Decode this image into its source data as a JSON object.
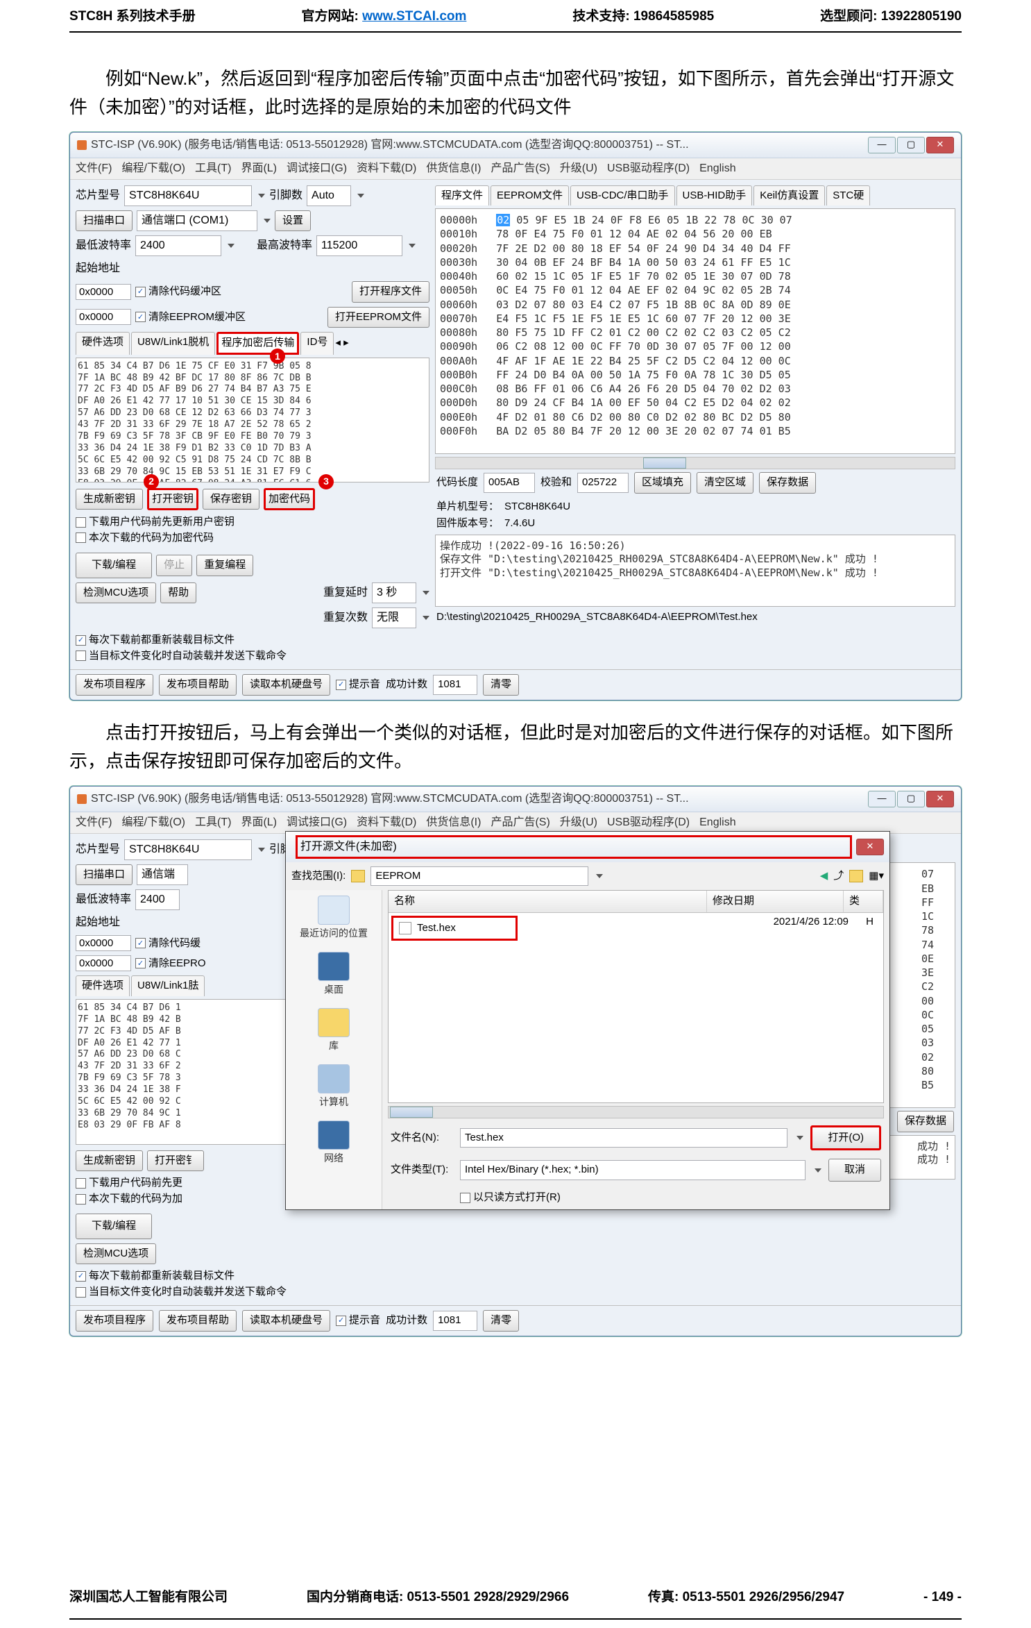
{
  "header": {
    "title": "STC8H 系列技术手册",
    "site_label": "官方网站: ",
    "site_url": "www.STCAI.com",
    "support": "技术支持: 19864585985",
    "consult": "选型顾问: 13922805190"
  },
  "para1": "例如“New.k”，然后返回到“程序加密后传输”页面中点击“加密代码”按钮，如下图所示，首先会弹出“打开源文件（未加密）”的对话框，此时选择的是原始的未加密的代码文件",
  "win": {
    "title": "STC-ISP (V6.90K) (服务电话/销售电话: 0513-55012928)  官网:www.STCMCUDATA.com  (选型咨询QQ:800003751) -- ST...",
    "menus": [
      "文件(F)",
      "编程/下载(O)",
      "工具(T)",
      "界面(L)",
      "调试接口(G)",
      "资料下载(D)",
      "供货信息(I)",
      "产品广告(S)",
      "升级(U)",
      "USB驱动程序(D)",
      "English"
    ],
    "chip_label": "芯片型号",
    "chip_value": "STC8H8K64U",
    "pin_label": "引脚数",
    "pin_value": "Auto",
    "set_btn": "设置",
    "scan_label": "扫描串口",
    "scan_value": "通信端口 (COM1)",
    "baud_min_label": "最低波特率",
    "baud_min": "2400",
    "baud_max_label": "最高波特率",
    "baud_max": "115200",
    "addr_label": "起始地址",
    "addr1": "0x0000",
    "addr2": "0x0000",
    "clear_code": "清除代码缓冲区",
    "clear_eeprom": "清除EEPROM缓冲区",
    "open_prog": "打开程序文件",
    "open_eeprom": "打开EEPROM文件",
    "hw_tabs": [
      "硬件选项",
      "U8W/Link1脱机",
      "程序加密后传输",
      "ID号"
    ],
    "key_block": "61 85 34 C4 B7 D6 1E 75 CF E0 31 F7 9B 05 8 \n7F 1A BC 48 B9 42 BF DC 17 80 8F 86 7C DB B \n77 2C F3 4D D5 AF B9 D6 27 74 B4 B7 A3 75 E \nDF A0 26 E1 42 77 17 10 51 30 CE 15 3D 84 6 \n57 A6 DD 23 D0 68 CE 12 D2 63 66 D3 74 77 3 \n43 7F 2D 31 33 6F 29 7E 18 A7 2E 52 78 65 2 \n7B F9 69 C3 5F 78 3F CB 9F E0 FE B0 70 79 3 \n33 36 D4 24 1E 38 F9 D1 B2 33 C0 1D 7D B3 A \n5C 6C E5 42 00 92 C5 91 D8 75 24 CD 7C 8B B \n33 6B 29 70 84 9C 15 EB 53 51 1E 31 E7 F9 C \nE8 03 29 0F FB AF 82 67 08 24 A3 81 FC C1 6 ",
    "badge1": "1",
    "badge2": "2",
    "badge3": "3",
    "gen_key": "生成新密钥",
    "open_key": "打开密钥",
    "save_key": "保存密钥",
    "encrypt": "加密代码",
    "chk1": "下载用户代码前先更新用户密钥",
    "chk2": "本次下载的代码为加密代码",
    "dl_btn": "下载/编程",
    "stop_btn": "停止",
    "repeat_btn": "重复编程",
    "detect_btn": "检测MCU选项",
    "help_btn": "帮助",
    "delay_label": "重复延时",
    "delay_val": "3 秒",
    "times_label": "重复次数",
    "times_val": "无限",
    "chk3": "每次下载前都重新装载目标文件",
    "chk4": "当目标文件变化时自动装载并发送下载命令",
    "right_tabs": [
      "程序文件",
      "EEPROM文件",
      "USB-CDC/串口助手",
      "USB-HID助手",
      "Keil仿真设置",
      "STC硬"
    ],
    "hex_lines": [
      "00000h   02 05 9F E5 1B 24 0F F8 E6 05 1B 22 78 0C 30 07",
      "00010h   78 0F E4 75 F0 01 12 04 AE 02 04 56 20 00 EB",
      "00020h   7F 2E D2 00 80 18 EF 54 0F 24 90 D4 34 40 D4 FF",
      "00030h   30 04 0B EF 24 BF B4 1A 00 50 03 24 61 FF E5 1C",
      "00040h   60 02 15 1C 05 1F E5 1F 70 02 05 1E 30 07 0D 78",
      "00050h   0C E4 75 F0 01 12 04 AE EF 02 04 9C 02 05 2B 74",
      "00060h   03 D2 07 80 03 E4 C2 07 F5 1B 8B 0C 8A 0D 89 0E",
      "00070h   E4 F5 1C F5 1E F5 1E E5 1C 60 07 7F 20 12 00 3E",
      "00080h   80 F5 75 1D FF C2 01 C2 00 C2 02 C2 03 C2 05 C2",
      "00090h   06 C2 08 12 00 0C FF 70 0D 30 07 05 7F 00 12 00",
      "000A0h   4F AF 1F AE 1E 22 B4 25 5F C2 D5 C2 04 12 00 0C",
      "000B0h   FF 24 D0 B4 0A 00 50 1A 75 F0 0A 78 1C 30 D5 05",
      "000C0h   08 B6 FF 01 06 C6 A4 26 F6 20 D5 04 70 02 D2 03",
      "000D0h   80 D9 24 CF B4 1A 00 EF 50 04 C2 E5 D2 04 02 02",
      "000E0h   4F D2 01 80 C6 D2 00 80 C0 D2 02 80 BC D2 D5 80",
      "000F0h   BA D2 05 80 B4 7F 20 12 00 3E 20 02 07 74 01 B5"
    ],
    "len_label": "代码长度",
    "len_val": "005AB",
    "chk_label": "校验和",
    "chk_val": "025722",
    "fill_btn": "区域填充",
    "clear_btn": "清空区域",
    "save_btn": "保存数据",
    "mcu_label": "单片机型号：",
    "mcu_val": "STC8H8K64U",
    "fw_label": "固件版本号：",
    "fw_val": "7.4.6U",
    "log": "操作成功 !(2022-09-16 16:50:26)\n保存文件 \"D:\\testing\\20210425_RH0029A_STC8A8K64D4-A\\EEPROM\\New.k\" 成功 !\n打开文件 \"D:\\testing\\20210425_RH0029A_STC8A8K64D4-A\\EEPROM\\New.k\" 成功 !",
    "path": "D:\\testing\\20210425_RH0029A_STC8A8K64D4-A\\EEPROM\\Test.hex",
    "pub_prog": "发布项目程序",
    "pub_help": "发布项目帮助",
    "read_hdd": "读取本机硬盘号",
    "beep": "提示音",
    "count_label": "成功计数",
    "count_val": "1081",
    "clear0": "清零"
  },
  "para2": "点击打开按钮后，马上有会弹出一个类似的对话框，但此时是对加密后的文件进行保存的对话框。如下图所示，点击保存按钮即可保存加密后的文件。",
  "dlg": {
    "title": "打开源文件(未加密)",
    "range_label": "查找范围(I):",
    "folder": "EEPROM",
    "cols": {
      "name": "名称",
      "date": "修改日期",
      "type": "类"
    },
    "file": {
      "name": "Test.hex",
      "date": "2021/4/26 12:09",
      "type": "H"
    },
    "places": [
      "最近访问的位置",
      "桌面",
      "库",
      "计算机",
      "网络"
    ],
    "fname_label": "文件名(N):",
    "fname": "Test.hex",
    "ftype_label": "文件类型(T):",
    "ftype": "Intel Hex/Binary (*.hex; *.bin)",
    "readonly": "以只读方式打开(R)",
    "open": "打开(O)",
    "cancel": "取消"
  },
  "win2": {
    "right_side": [
      "07",
      "EB",
      "FF",
      "1C",
      "78",
      "74",
      "0E",
      "3E",
      "C2",
      "00",
      "0C",
      "05",
      "03",
      "02",
      "80",
      "B5"
    ],
    "log": "成功 !\n成功 !"
  },
  "footer": {
    "company": "深圳国芯人工智能有限公司",
    "phone": "国内分销商电话: 0513-5501 2928/2929/2966",
    "fax": "传真: 0513-5501 2926/2956/2947",
    "page": "- 149 -"
  }
}
